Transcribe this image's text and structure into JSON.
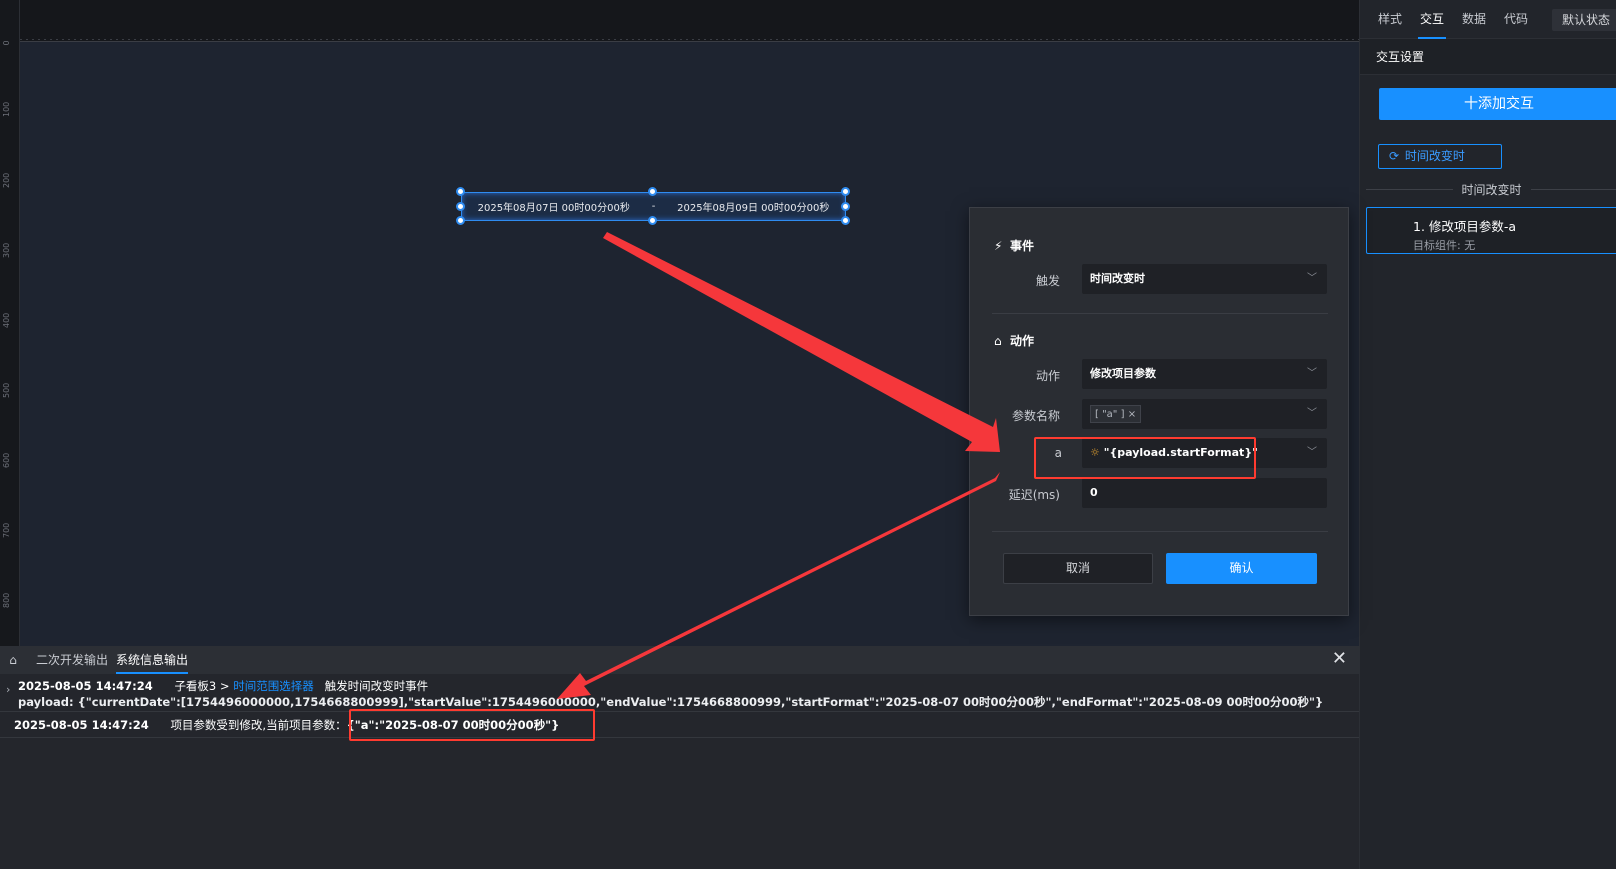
{
  "ruler": {
    "ticks": [
      "0",
      "100",
      "200",
      "300",
      "400",
      "500",
      "600",
      "700",
      "800"
    ]
  },
  "date_range": {
    "start": "2025年08月07日 00时00分00秒",
    "separator": "-",
    "end": "2025年08月09日 00时00分00秒"
  },
  "right_panel": {
    "tabs": [
      "样式",
      "交互",
      "数据",
      "代码"
    ],
    "active_tab": "交互",
    "state_label": "默认状态",
    "section_title": "交互设置",
    "add_button": "十添加交互",
    "event_tag": "时间改变时",
    "divider_label": "时间改变时",
    "card": {
      "title": "1. 修改项目参数-a",
      "subtitle": "目标组件: 无"
    }
  },
  "popup": {
    "event_header": "事件",
    "trigger_label": "触发",
    "trigger_value": "时间改变时",
    "action_header": "动作",
    "action_label": "动作",
    "action_value": "修改项目参数",
    "param_label": "参数名称",
    "param_chip": "[ \"a\" ]",
    "param_chip_close": "×",
    "a_label": "a",
    "a_value": "\"{payload.startFormat}\"",
    "delay_label": "延迟(ms)",
    "delay_value": "0",
    "cancel": "取消",
    "confirm": "确认"
  },
  "console": {
    "tabs": [
      "二次开发输出",
      "系统信息输出"
    ],
    "active_tab": "系统信息输出",
    "logs": [
      {
        "time": "2025-08-05 14:47:24",
        "board": "子看板3 >",
        "component": "时间范围选择器",
        "message": "触发时间改变时事件",
        "payload": "payload: {\"currentDate\":[1754496000000,1754668800999],\"startValue\":1754496000000,\"endValue\":1754668800999,\"startFormat\":\"2025-08-07 00时00分00秒\",\"endFormat\":\"2025-08-09 00时00分00秒\"}"
      },
      {
        "time": "2025-08-05 14:47:24",
        "message": "项目参数受到修改,当前项目参数：",
        "value": "{\"a\":\"2025-08-07 00时00分00秒\"}"
      }
    ]
  },
  "colors": {
    "accent": "#1890ff",
    "highlight": "#ff3b30",
    "background": "#1b1e24"
  }
}
